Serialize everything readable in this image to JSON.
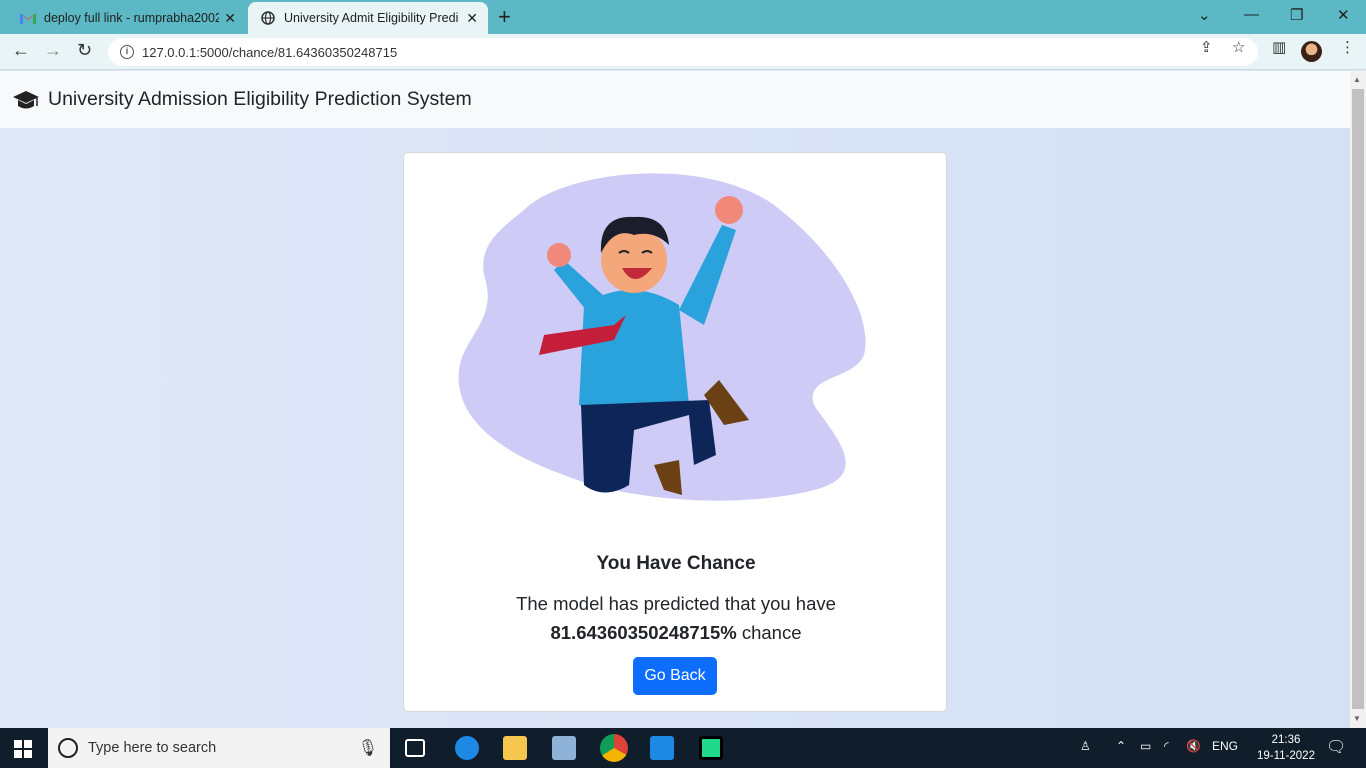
{
  "browser": {
    "tabs": [
      {
        "title": "deploy full link - rumprabha2002",
        "close": "✕"
      },
      {
        "title": "University Admit Eligibility Predic",
        "close": "✕"
      }
    ],
    "new_tab": "+",
    "url": "127.0.0.1:5000/chance/81.64360350248715"
  },
  "navbar": {
    "brand": "University Admission Eligibility Prediction System"
  },
  "card": {
    "title": "You Have Chance",
    "text_prefix": "The model has predicted that you have",
    "chance_value": "81.64360350248715%",
    "text_suffix": " chance",
    "button": "Go Back"
  },
  "taskbar": {
    "search_placeholder": "Type here to search",
    "language": "ENG",
    "time": "21:36",
    "date": "19-11-2022"
  },
  "colors": {
    "tab_bar": "#5bb8c4",
    "primary_button": "#0d6efd",
    "blob": "#cfcbf7"
  }
}
